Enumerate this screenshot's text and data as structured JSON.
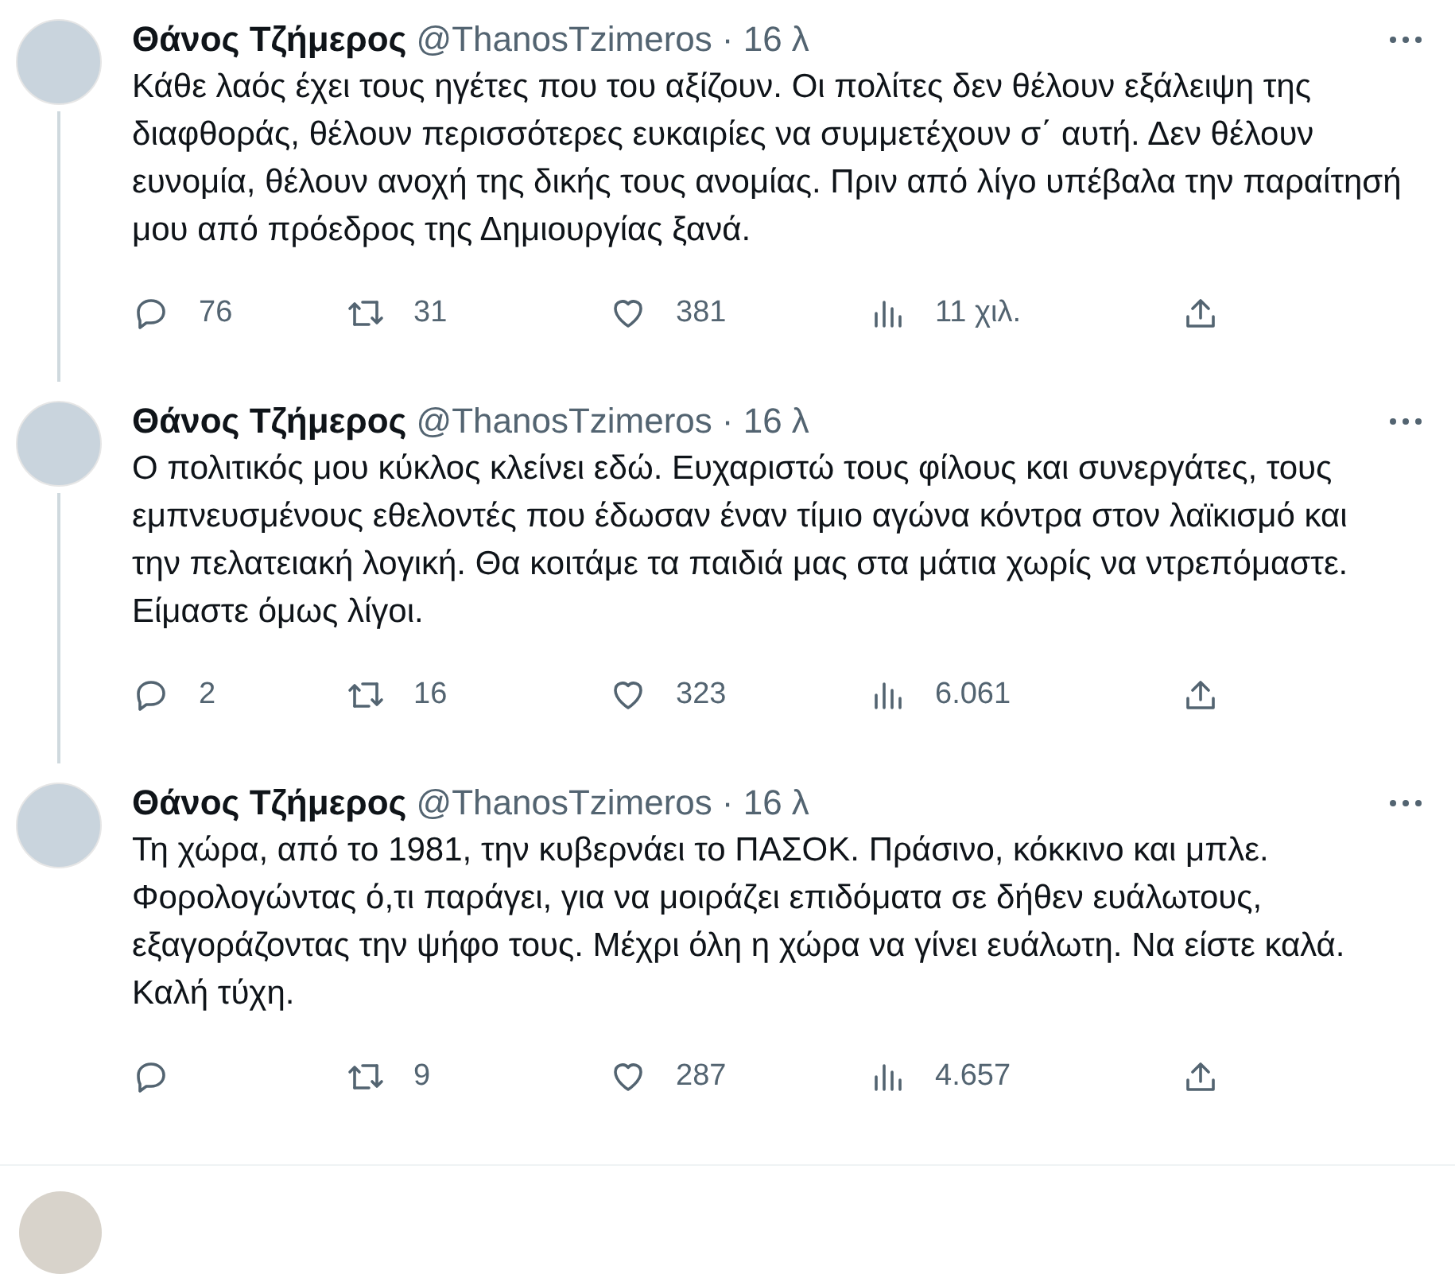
{
  "tweets": [
    {
      "name": "Θάνος Τζήμερος",
      "handle": "@ThanosTzimeros",
      "time": "· 16 λ",
      "threaded": true,
      "text": "Κάθε λαός έχει τους ηγέτες που του αξίζουν. Οι πολίτες δεν θέλουν εξάλειψη της διαφθοράς, θέλουν περισσότερες ευκαιρίες να συμμετέχουν σ΄ αυτή. Δεν θέλουν ευνομία, θέλουν ανοχή της δικής τους ανομίας. Πριν από λίγο υπέβαλα την παραίτησή μου από πρόεδρος της Δημιουργίας ξανά.",
      "replies": "76",
      "retweets": "31",
      "likes": "381",
      "views": "11 χιλ."
    },
    {
      "name": "Θάνος Τζήμερος",
      "handle": "@ThanosTzimeros",
      "time": "· 16 λ",
      "threaded": true,
      "text": "Ο πολιτικός μου κύκλος κλείνει εδώ. Ευχαριστώ τους φίλους και συνεργάτες, τους εμπνευσμένους εθελοντές που έδωσαν έναν τίμιο αγώνα κόντρα στον λαϊκισμό και την πελατειακή λογική. Θα κοιτάμε τα παιδιά μας στα μάτια χωρίς να ντρεπόμαστε. Είμαστε όμως λίγοι.",
      "replies": "2",
      "retweets": "16",
      "likes": "323",
      "views": "6.061"
    },
    {
      "name": "Θάνος Τζήμερος",
      "handle": "@ThanosTzimeros",
      "time": "· 16 λ",
      "threaded": false,
      "text": "Τη χώρα, από το 1981, την κυβερνάει το ΠΑΣΟΚ. Πράσινο, κόκκινο και μπλε. Φορολογώντας ό,τι παράγει, για να μοιράζει επιδόματα σε δήθεν ευάλωτους, εξαγοράζοντας την ψήφο τους. Μέχρι όλη η χώρα να γίνει ευάλωτη. Να είστε καλά. Καλή τύχη.",
      "retweets": "9",
      "likes": "287",
      "views": "4.657"
    }
  ]
}
